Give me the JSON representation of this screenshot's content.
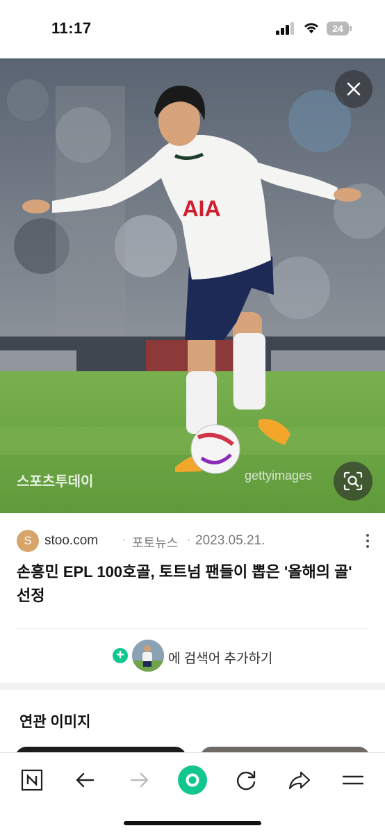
{
  "status_bar": {
    "time": "11:17",
    "battery_level": "24"
  },
  "photo": {
    "watermark_left": "스포츠투데이",
    "watermark_right": "gettyimages",
    "jersey_text": "AIA"
  },
  "article": {
    "source_initial": "S",
    "source_name": "stoo.com",
    "category": "포토뉴스",
    "date": "2023.05.21.",
    "title": "손흥민 EPL 100호골, 토트넘 팬들이 뽑은 '올해의 골' 선정",
    "add_search_label": "에 검색어 추가하기"
  },
  "related": {
    "title": "연관 이미지"
  },
  "colors": {
    "accent_green": "#12c690",
    "source_avatar": "#d7a46a"
  },
  "icons": {
    "toolbar": [
      "naver-n-icon",
      "back-arrow-icon",
      "forward-arrow-icon",
      "green-dot-icon",
      "refresh-icon",
      "share-icon",
      "menu-icon"
    ]
  }
}
